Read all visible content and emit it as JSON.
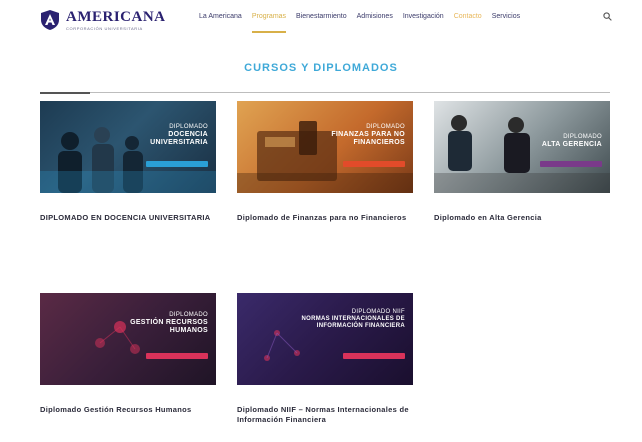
{
  "header": {
    "logo_name": "AMERICANA",
    "logo_sub": "CORPORACIÓN UNIVERSITARIA",
    "nav": [
      {
        "label": "La Americana",
        "state": "normal"
      },
      {
        "label": "Programas",
        "state": "active"
      },
      {
        "label": "Bienestarmiento",
        "state": "normal"
      },
      {
        "label": "Admisiones",
        "state": "normal"
      },
      {
        "label": "Investigación",
        "state": "normal"
      },
      {
        "label": "Contacto",
        "state": "highlight"
      },
      {
        "label": "Servicios",
        "state": "normal"
      }
    ],
    "search_icon": "search-icon"
  },
  "page": {
    "title": "CURSOS Y DIPLOMADOS"
  },
  "cards": [
    {
      "thumb_line1": "DIPLOMADO",
      "thumb_line2": "DOCENCIA",
      "thumb_line3": "UNIVERSITARIA",
      "title": "DIPLOMADO EN DOCENCIA UNIVERSITARIA",
      "thumb_color": "#1f3d57",
      "tag_color": "#2a9fd6"
    },
    {
      "thumb_line1": "DIPLOMADO",
      "thumb_line2": "FINANZAS PARA NO",
      "thumb_line3": "FINANCIEROS",
      "title": "Diplomado de Finanzas para no Financieros",
      "thumb_color": "#c46a2c",
      "tag_color": "#e24b2a"
    },
    {
      "thumb_line1": "DIPLOMADO",
      "thumb_line2": "ALTA GERENCIA",
      "thumb_line3": "",
      "title": "Diplomado en Alta Gerencia",
      "thumb_color": "#4e5a5e",
      "tag_color": "#7a3a8a"
    },
    {
      "thumb_line1": "DIPLOMADO",
      "thumb_line2": "GESTIÓN RECURSOS",
      "thumb_line3": "HUMANOS",
      "title": "Diplomado Gestión Recursos Humanos",
      "thumb_color": "#3a1f3a",
      "tag_color": "#d9325a"
    },
    {
      "thumb_line1": "DIPLOMADO NIIF",
      "thumb_line2": "NORMAS INTERNACIONALES DE",
      "thumb_line3": "INFORMACIÓN FINANCIERA",
      "title": "Diplomado NIIF – Normas Internacionales de Información Financiera",
      "thumb_color": "#2a1a4a",
      "tag_color": "#d9325a"
    }
  ]
}
